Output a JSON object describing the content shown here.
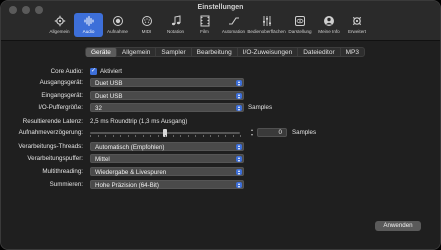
{
  "window": {
    "title": "Einstellungen"
  },
  "toolbar": {
    "items": [
      {
        "label": "Allgemein",
        "icon": "gear-icon"
      },
      {
        "label": "Audio",
        "icon": "waveform-icon",
        "selected": true
      },
      {
        "label": "Aufnahme",
        "icon": "record-icon"
      },
      {
        "label": "MIDI",
        "icon": "midi-icon"
      },
      {
        "label": "Notation",
        "icon": "notes-icon"
      },
      {
        "label": "Film",
        "icon": "film-icon"
      },
      {
        "label": "Automation",
        "icon": "automation-icon"
      },
      {
        "label": "Bedienoberflächen",
        "icon": "sliders-icon"
      },
      {
        "label": "Darstellung",
        "icon": "eye-icon"
      },
      {
        "label": "Meine Info",
        "icon": "person-icon"
      },
      {
        "label": "Erweitert",
        "icon": "advanced-gear-icon"
      }
    ]
  },
  "tabs": [
    "Geräte",
    "Allgemein",
    "Sampler",
    "Bearbeitung",
    "I/O-Zuweisungen",
    "Dateieditor",
    "MP3"
  ],
  "selected_tab": "Geräte",
  "form": {
    "core_audio": {
      "label": "Core Audio:",
      "value": "Aktiviert",
      "checked": true
    },
    "output": {
      "label": "Ausgangsgerät:",
      "value": "Duet USB"
    },
    "input": {
      "label": "Eingangsgerät:",
      "value": "Duet USB"
    },
    "buffer": {
      "label": "I/O-Puffergröße:",
      "value": "32",
      "unit": "Samples"
    },
    "latency": {
      "label": "Resultierende Latenz:",
      "value": "2,5 ms Roundtrip (1,3 ms Ausgang)"
    },
    "record_delay": {
      "label": "Aufnahmeverzögerung:",
      "value": "0",
      "unit": "Samples",
      "level": 0.5
    },
    "threads": {
      "label": "Verarbeitungs-Threads:",
      "value": "Automatisch (Empfohlen)"
    },
    "process_buffer": {
      "label": "Verarbeitungspuffer:",
      "value": "Mittel"
    },
    "multithreading": {
      "label": "Multithreading:",
      "value": "Wiedergabe & Livespuren"
    },
    "summing": {
      "label": "Summieren:",
      "value": "Hohe Präzision (64-Bit)"
    }
  },
  "apply_label": "Anwenden",
  "colors": {
    "accent": "#3d6fd9",
    "background": "#1f1f1f"
  }
}
